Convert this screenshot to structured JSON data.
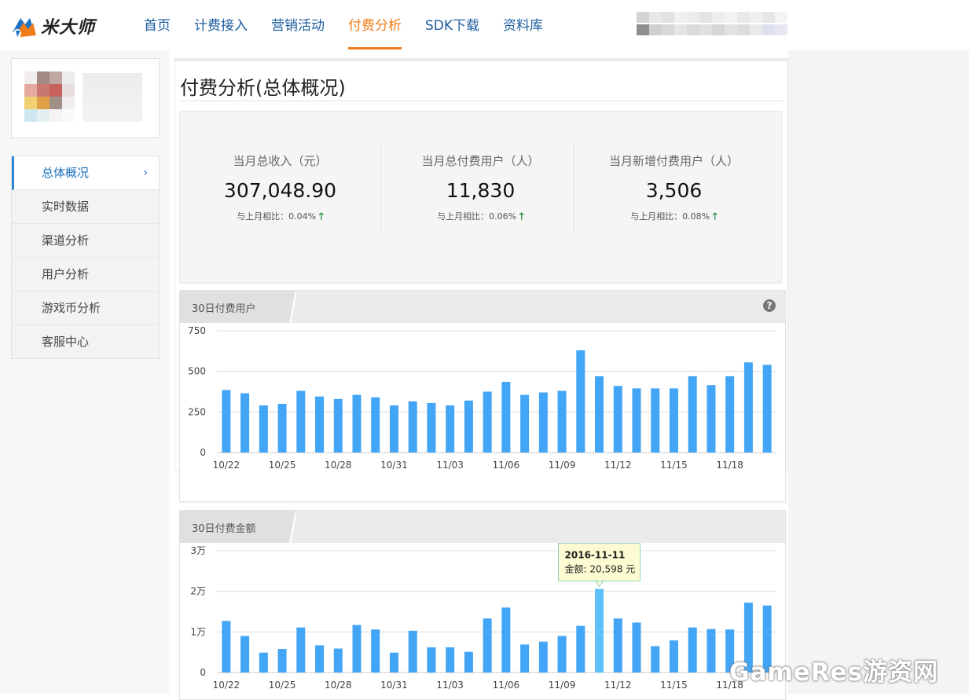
{
  "brand": {
    "name": "米大师"
  },
  "nav": {
    "items": [
      "首页",
      "计费接入",
      "营销活动",
      "付费分析",
      "SDK下载",
      "资料库"
    ],
    "active_index": 3
  },
  "sidebar": {
    "items": [
      "总体概况",
      "实时数据",
      "渠道分析",
      "用户分析",
      "游戏币分析",
      "客服中心"
    ],
    "active_index": 0
  },
  "page": {
    "title": "付费分析(总体概况)"
  },
  "stats": [
    {
      "label": "当月总收入（元）",
      "value": "307,048.90",
      "compare": "与上月相比：0.04%"
    },
    {
      "label": "当月总付费用户（人）",
      "value": "11,830",
      "compare": "与上月相比：0.06%"
    },
    {
      "label": "当月新增付费用户（人）",
      "value": "3,506",
      "compare": "与上月相比：0.08%"
    }
  ],
  "colors": {
    "accent": "#f07d1a",
    "nav_link": "#1a5b9e",
    "bar": "#42a5f5",
    "bar_highlight": "#5ec0fb",
    "up_arrow": "#1a8a3a"
  },
  "chart_data": [
    {
      "type": "bar",
      "title": "30日付费用户",
      "x": [
        "10/22",
        "10/23",
        "10/24",
        "10/25",
        "10/26",
        "10/27",
        "10/28",
        "10/29",
        "10/30",
        "10/31",
        "11/01",
        "11/02",
        "11/03",
        "11/04",
        "11/05",
        "11/06",
        "11/07",
        "11/08",
        "11/09",
        "11/10",
        "11/11",
        "11/12",
        "11/13",
        "11/14",
        "11/15",
        "11/16",
        "11/17",
        "11/18",
        "11/19",
        "11/20"
      ],
      "values": [
        385,
        365,
        290,
        300,
        380,
        345,
        330,
        355,
        340,
        290,
        315,
        305,
        290,
        320,
        375,
        435,
        355,
        370,
        380,
        630,
        470,
        410,
        395,
        395,
        395,
        470,
        415,
        470,
        555,
        540
      ],
      "tick_labels": [
        "10/22",
        "10/25",
        "10/28",
        "10/31",
        "11/03",
        "11/06",
        "11/09",
        "11/12",
        "11/15",
        "11/18"
      ],
      "y_ticks": [
        "0",
        "250",
        "500",
        "750"
      ],
      "ylim": [
        0,
        750
      ],
      "grid": true
    },
    {
      "type": "bar",
      "title": "30日付费金额",
      "x": [
        "10/22",
        "10/23",
        "10/24",
        "10/25",
        "10/26",
        "10/27",
        "10/28",
        "10/29",
        "10/30",
        "10/31",
        "11/01",
        "11/02",
        "11/03",
        "11/04",
        "11/05",
        "11/06",
        "11/07",
        "11/08",
        "11/09",
        "11/10",
        "11/11",
        "11/12",
        "11/13",
        "11/14",
        "11/15",
        "11/16",
        "11/17",
        "11/18",
        "11/19",
        "11/20"
      ],
      "values": [
        12700,
        9000,
        4900,
        5800,
        11100,
        6700,
        5900,
        11700,
        10600,
        4900,
        10300,
        6200,
        6200,
        5100,
        13300,
        16000,
        6900,
        7600,
        9000,
        11500,
        20598,
        13300,
        12300,
        6500,
        7900,
        11100,
        10700,
        10600,
        17200,
        16500
      ],
      "tick_labels": [
        "10/22",
        "10/25",
        "10/28",
        "10/31",
        "11/03",
        "11/06",
        "11/09",
        "11/12",
        "11/15",
        "11/18"
      ],
      "y_ticks": [
        "0",
        "1万",
        "2万",
        "3万"
      ],
      "ylim": [
        0,
        30000
      ],
      "grid": true,
      "highlight_index": 20,
      "tooltip": {
        "date": "2016-11-11",
        "text": "金额: 20,598 元"
      }
    }
  ],
  "watermark": "GameRes游资网"
}
